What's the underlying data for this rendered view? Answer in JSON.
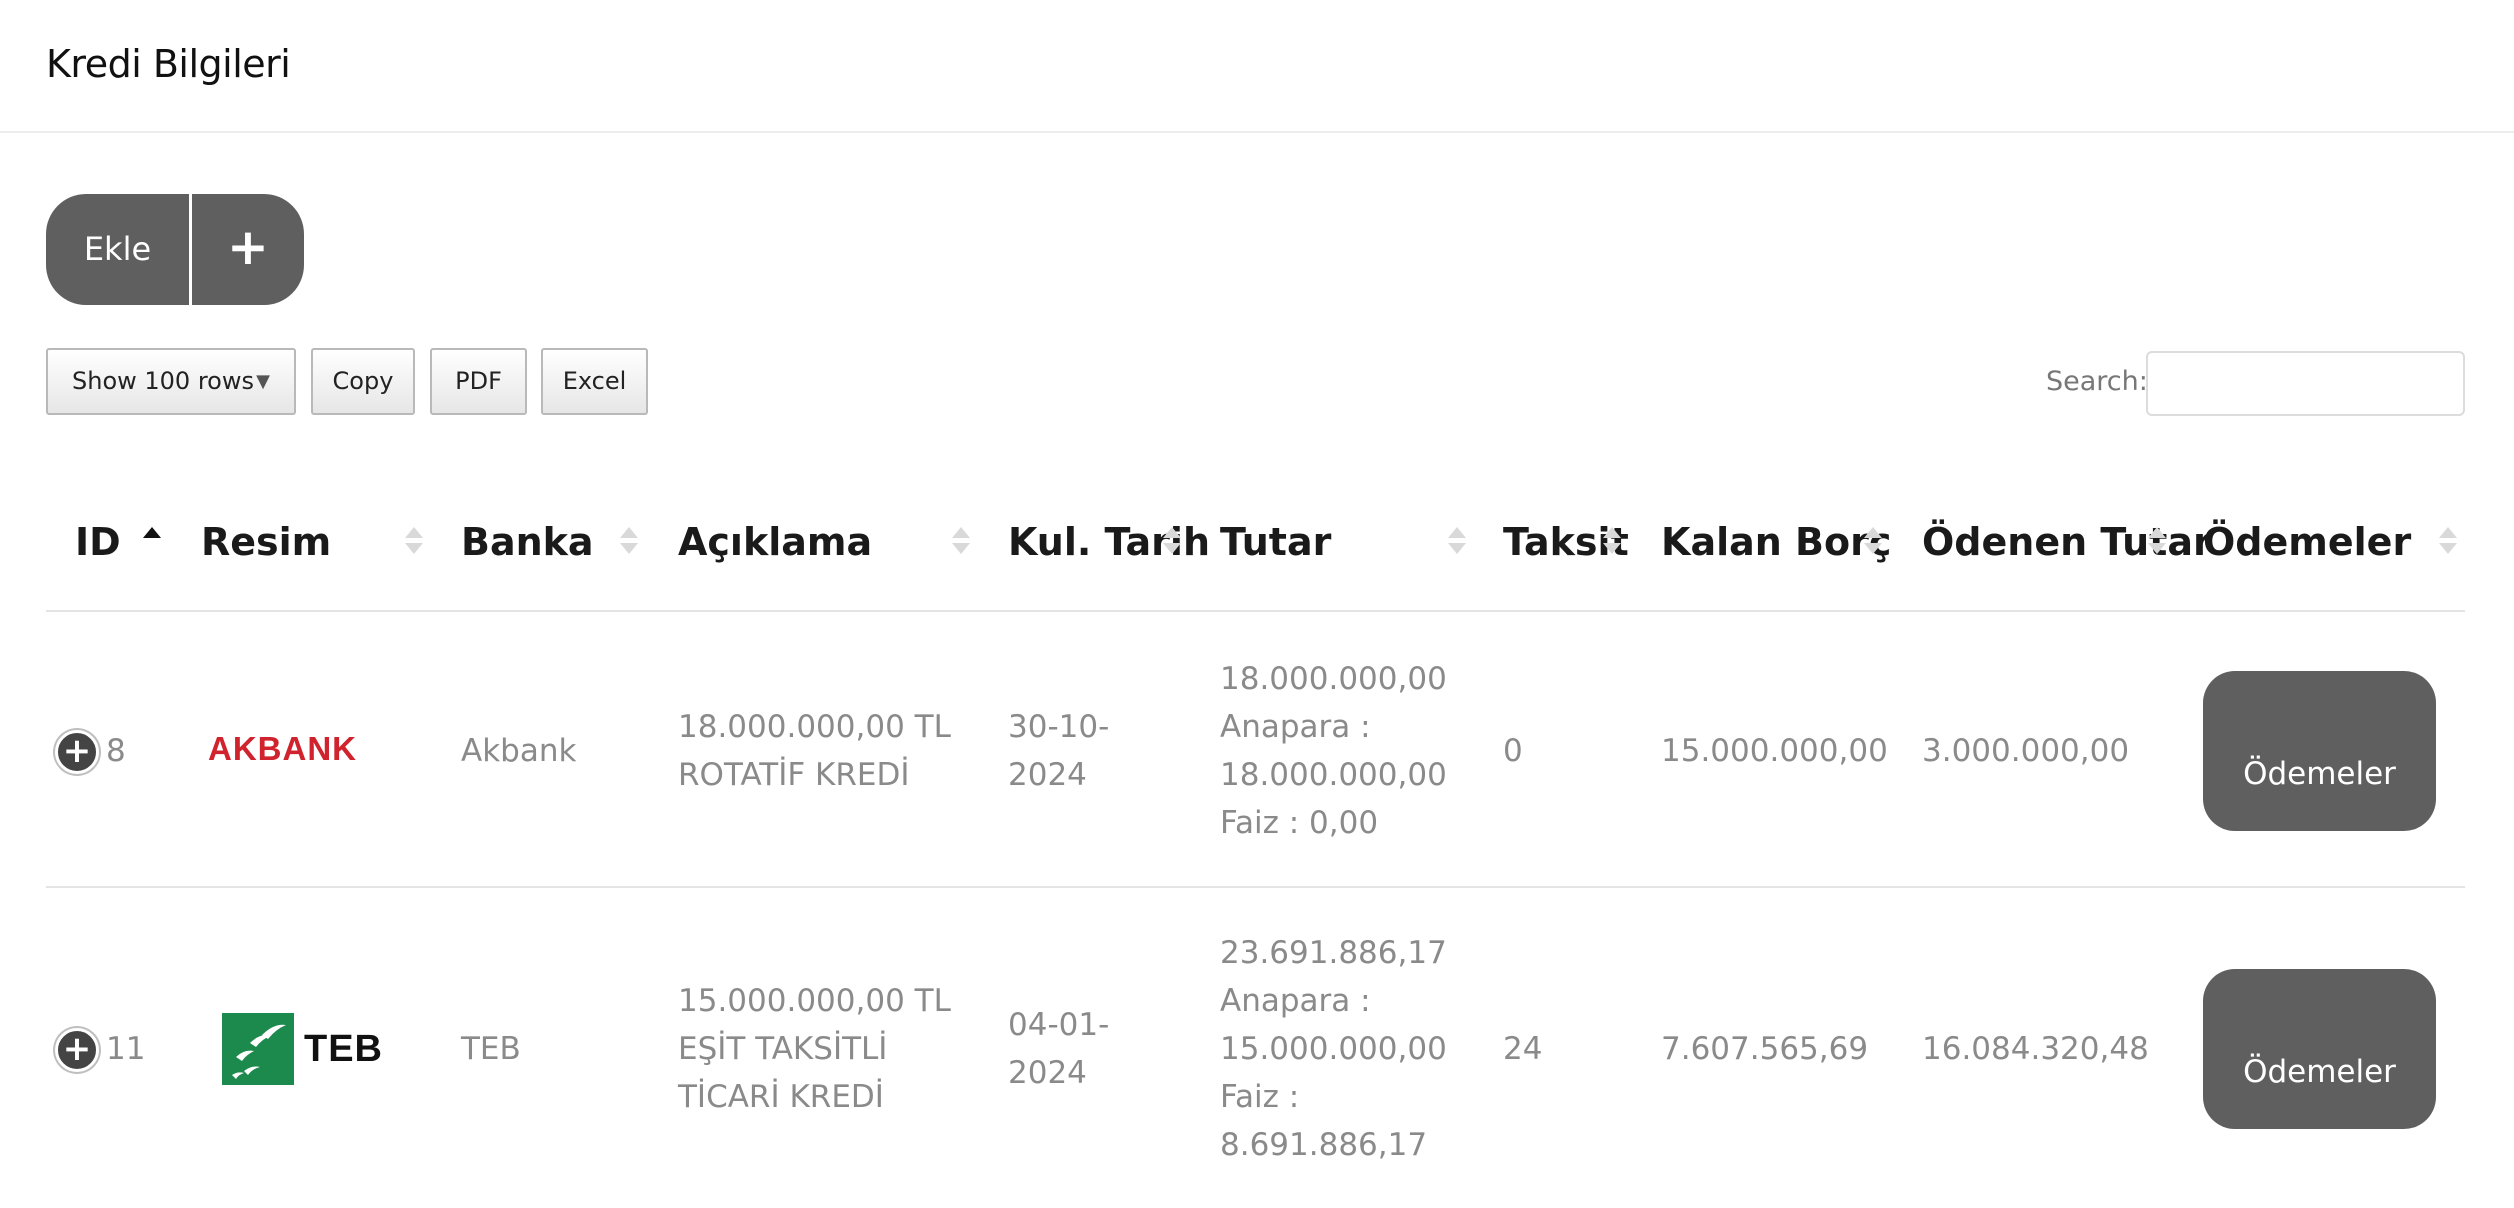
{
  "page": {
    "title": "Kredi Bilgileri"
  },
  "toolbar": {
    "add_label": "Ekle",
    "add_icon": "+",
    "rows_select": "Show 100 rows",
    "copy": "Copy",
    "pdf": "PDF",
    "excel": "Excel",
    "search_label": "Search:",
    "search_value": ""
  },
  "table": {
    "columns": [
      "ID",
      "Resim",
      "Banka",
      "Açıklama",
      "Kul. Tarih",
      "Tutar",
      "Taksit",
      "Kalan Borç",
      "Ödenen Tutar",
      "Ödemeler"
    ],
    "sorted_column": "ID",
    "sort_direction": "asc",
    "rows": [
      {
        "id": "8",
        "logo": "akbank-logo",
        "logo_text": "AKBANK",
        "bank": "Akbank",
        "desc": [
          "18.000.000,00 TL",
          "ROTATİF KREDİ"
        ],
        "date": [
          "30-10-",
          "2024"
        ],
        "amount": [
          "18.000.000,00",
          "Anapara :",
          "18.000.000,00",
          "Faiz : 0,00"
        ],
        "installments": "0",
        "remaining": "15.000.000,00",
        "paid": "3.000.000,00",
        "button": "Ödemeler"
      },
      {
        "id": "11",
        "logo": "teb-logo",
        "logo_text": "TEB",
        "bank": "TEB",
        "desc": [
          "15.000.000,00 TL",
          "EŞİT TAKSİTLİ",
          "TİCARİ KREDİ"
        ],
        "date": [
          "04-01-",
          "2024"
        ],
        "amount": [
          "23.691.886,17",
          "Anapara :",
          "15.000.000,00",
          "Faiz :",
          "8.691.886,17"
        ],
        "installments": "24",
        "remaining": "7.607.565,69",
        "paid": "16.084.320,48",
        "button": "Ödemeler"
      }
    ]
  },
  "colors": {
    "button_bg": "#5f5f5f",
    "akbank_red": "#d0232d",
    "teb_green": "#1b8a4c",
    "cell_text": "#8a8a8a"
  }
}
